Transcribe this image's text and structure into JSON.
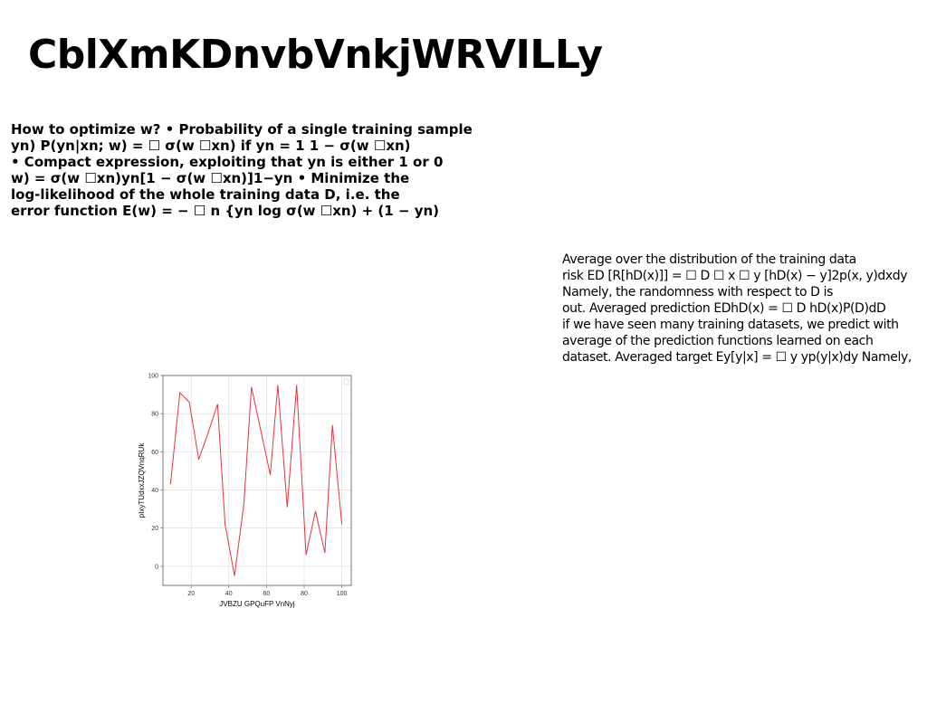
{
  "slide": {
    "title": "CblXmKDnvbVnkjWRVILLy",
    "bold_lines": [
      "How to optimize w? • Probability of a single training sample",
      "yn) P(yn|xn; w) = ☐ σ(w ☐xn) if yn = 1 1 − σ(w ☐xn)",
      "• Compact expression, exploiting that yn is either 1 or 0",
      "w) = σ(w ☐xn)yn[1 − σ(w ☐xn)]1−yn • Minimize the",
      "log-likelihood of the whole training data D, i.e. the",
      "error function E(w) = − ☐ n {yn log σ(w ☐xn) + (1 − yn)"
    ],
    "right_lines": [
      "Average over the distribution of the training data",
      "risk ED [R[hD(x)]] = ☐ D ☐ x ☐ y [hD(x) − y]2p(x, y)dxdy",
      "Namely, the randomness with respect to D is",
      "out. Averaged prediction EDhD(x) = ☐ D hD(x)P(D)dD",
      "if we have seen many training datasets, we predict with",
      "average of the prediction functions learned on each",
      "dataset. Averaged target Ey[y|x] = ☐ y yp(y|x)dy Namely,"
    ]
  },
  "chart_data": {
    "type": "line",
    "xlabel": "JVBZU GPQuFP VnNyj",
    "ylabel": "pIxyTUdxxJZQVnqRUk",
    "xlim": [
      5,
      105
    ],
    "ylim": [
      -10,
      100
    ],
    "xticks": [
      20,
      40,
      60,
      80,
      100
    ],
    "yticks": [
      0,
      20,
      40,
      60,
      80,
      100
    ],
    "grid": true,
    "series": [
      {
        "color": "#e8333a",
        "x": [
          9,
          14,
          19,
          24,
          29,
          34,
          38,
          43,
          48,
          52,
          57,
          62,
          66,
          71,
          76,
          81,
          86,
          91,
          95,
          100
        ],
        "y": [
          43,
          91,
          86,
          56,
          70,
          85,
          22,
          -5,
          33,
          94,
          71,
          48,
          95,
          31,
          95,
          6,
          29,
          7,
          74,
          22
        ]
      }
    ]
  }
}
